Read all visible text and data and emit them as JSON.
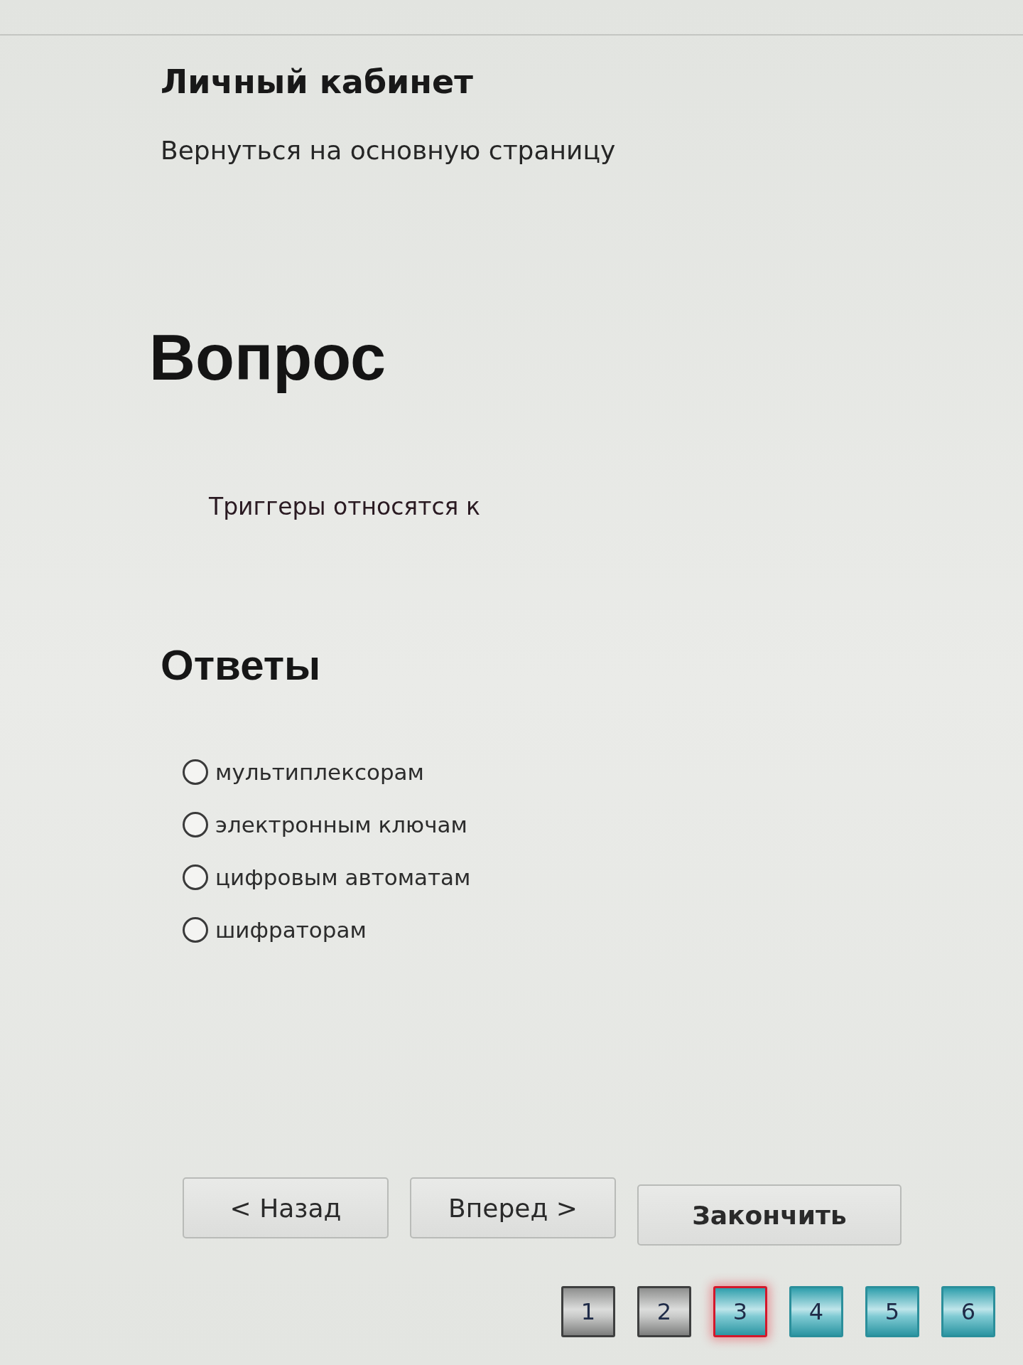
{
  "header": {
    "title": "Личный кабинет",
    "back_link": "Вернуться на основную страницу"
  },
  "question": {
    "heading": "Вопрос",
    "text": "Триггеры относятся к"
  },
  "answers": {
    "heading": "Ответы",
    "options": [
      {
        "label": "мультиплексорам",
        "selected": false
      },
      {
        "label": "электронным ключам",
        "selected": false
      },
      {
        "label": "цифровым автоматам",
        "selected": false
      },
      {
        "label": "шифраторам",
        "selected": false
      }
    ]
  },
  "buttons": [
    {
      "label": "< Назад",
      "kind": "nav"
    },
    {
      "label": "Вперед >",
      "kind": "nav"
    },
    {
      "label": "Закончить",
      "kind": "finish"
    }
  ],
  "pages": [
    {
      "label": "1",
      "visited": true,
      "selected": false
    },
    {
      "label": "2",
      "visited": true,
      "selected": false
    },
    {
      "label": "3",
      "visited": false,
      "selected": true
    },
    {
      "label": "4",
      "visited": false,
      "selected": false
    },
    {
      "label": "5",
      "visited": false,
      "selected": false
    },
    {
      "label": "6",
      "visited": false,
      "selected": false
    }
  ]
}
